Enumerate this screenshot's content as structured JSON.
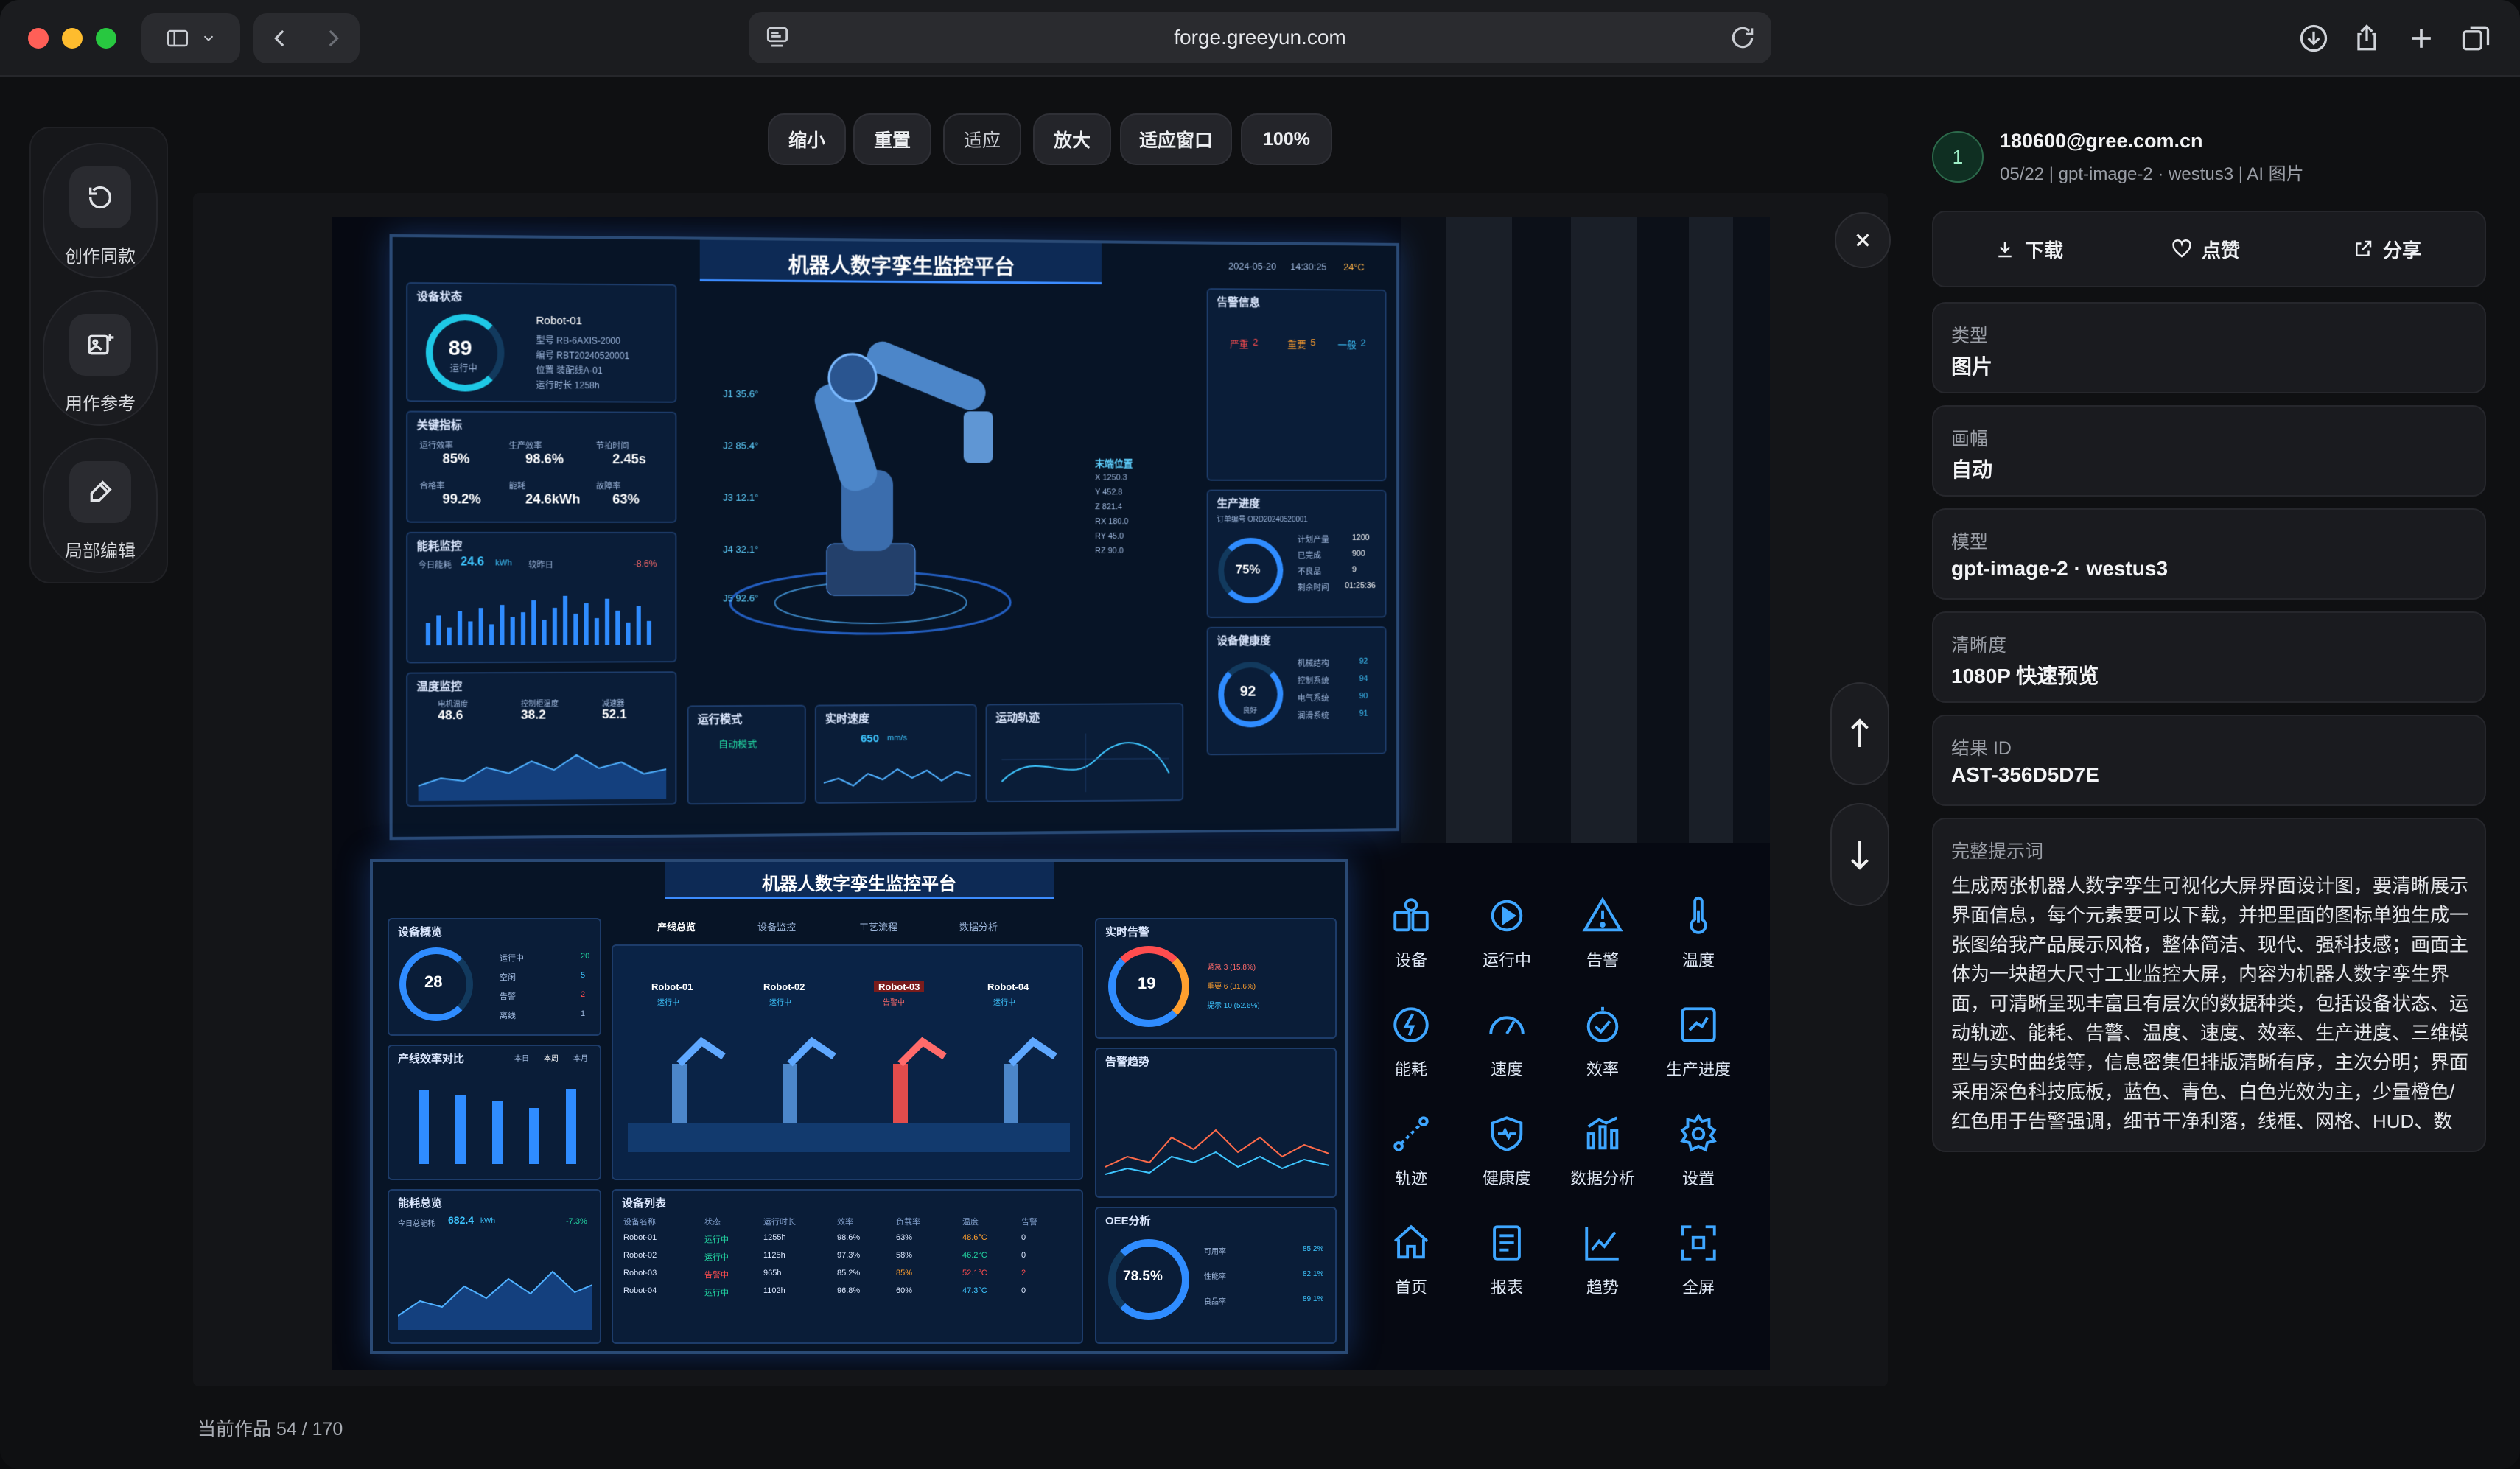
{
  "browser": {
    "url": "forge.greeyun.com"
  },
  "rail": {
    "items": [
      {
        "label": "创作同款",
        "icon": "rotate-ccw-icon"
      },
      {
        "label": "用作参考",
        "icon": "image-add-icon"
      },
      {
        "label": "局部编辑",
        "icon": "brush-edit-icon"
      }
    ]
  },
  "zoom": {
    "zoom_out": "缩小",
    "reset": "重置",
    "fit": "适应",
    "zoom_in": "放大",
    "fit_window": "适应窗口",
    "level": "100%"
  },
  "image": {
    "dashboard_title": "机器人数字孪生监控平台",
    "panel1": {
      "status_title": "设备状态",
      "status_value": "89",
      "status_sub": "运行中",
      "robot_name": "Robot-01",
      "model_line": "型号  RB-6AXIS-2000",
      "serial_line": "编号  RBT20240520001",
      "location_line": "位置  装配线A-01",
      "runtime_line": "运行时长  1258h",
      "kpi_title": "关键指标",
      "kpis": [
        {
          "label": "运行效率",
          "value": "85%"
        },
        {
          "label": "生产效率",
          "value": "98.6%"
        },
        {
          "label": "节拍时间",
          "value": "2.45s"
        },
        {
          "label": "合格率",
          "value": "99.2%"
        },
        {
          "label": "能耗",
          "value": "24.6kWh"
        },
        {
          "label": "故障率",
          "value": "63%"
        }
      ],
      "energy_title": "能耗监控",
      "energy_today": "今日能耗",
      "energy_value": "24.6",
      "energy_unit": "kWh",
      "energy_yoy": "较昨日",
      "energy_change": "-8.6%",
      "temp_title": "温度监控",
      "temps": [
        {
          "label": "电机温度",
          "value": "48.6"
        },
        {
          "label": "控制柜温度",
          "value": "38.2"
        },
        {
          "label": "减速器",
          "value": "52.1"
        }
      ],
      "mode_title": "运行模式",
      "mode_value": "自动模式",
      "speed_title": "实时速度",
      "speed_value": "650",
      "speed_unit": "mm/s",
      "track_title": "运动轨迹",
      "alarm_title": "告警信息",
      "alarm_counts": [
        {
          "label": "严重",
          "value": "2"
        },
        {
          "label": "重要",
          "value": "5"
        },
        {
          "label": "一般",
          "value": "2"
        }
      ],
      "progress_title": "生产进度",
      "progress_order": "订单编号  ORD20240520001",
      "progress_value": "75%",
      "progress_rows": [
        {
          "label": "计划产量",
          "value": "1200"
        },
        {
          "label": "已完成",
          "value": "900"
        },
        {
          "label": "不良品",
          "value": "9"
        },
        {
          "label": "剩余时间",
          "value": "01:25:36"
        }
      ],
      "health_title": "设备健康度",
      "health_value": "92",
      "health_sub": "良好",
      "health_rows": [
        {
          "label": "机械结构",
          "value": "92"
        },
        {
          "label": "控制系统",
          "value": "94"
        },
        {
          "label": "电气系统",
          "value": "90"
        },
        {
          "label": "润滑系统",
          "value": "91"
        }
      ],
      "joints": [
        "J1 35.6°",
        "J2 85.4°",
        "J3 12.1°",
        "J4 32.1°",
        "J5 92.6°"
      ],
      "end_pos_title": "末端位置",
      "end_pos": [
        "X 1250.3",
        "Y 452.8",
        "Z 821.4",
        "RX 180.0",
        "RY 45.0",
        "RZ 90.0"
      ],
      "date": "2024-05-20",
      "time": "14:30:25",
      "weather": "24°C"
    },
    "panel2": {
      "tabs": [
        "产线总览",
        "设备监控",
        "工艺流程",
        "数据分析"
      ],
      "overview_title": "设备概览",
      "overview_value": "28",
      "overview_rows": [
        {
          "label": "运行中",
          "value": "20"
        },
        {
          "label": "空闲",
          "value": "5"
        },
        {
          "label": "告警",
          "value": "2"
        },
        {
          "label": "离线",
          "value": "1"
        }
      ],
      "robots": [
        "Robot-01",
        "Robot-02",
        "Robot-03",
        "Robot-04"
      ],
      "robot_states": [
        "运行中",
        "运行中",
        "告警中",
        "运行中"
      ],
      "efficiency_title": "产线效率对比",
      "efficiency_tabs": [
        "本日",
        "本周",
        "本月"
      ],
      "energy_title": "能耗总览",
      "energy_today": "今日总能耗",
      "energy_value": "682.4",
      "energy_unit": "kWh",
      "energy_change": "-7.3%",
      "device_list_title": "设备列表",
      "device_headers": [
        "设备名称",
        "状态",
        "运行时长",
        "效率",
        "负载率",
        "温度",
        "告警"
      ],
      "device_rows": [
        [
          "Robot-01",
          "运行中",
          "1255h",
          "98.6%",
          "63%",
          "48.6°C",
          "0"
        ],
        [
          "Robot-02",
          "运行中",
          "1125h",
          "97.3%",
          "58%",
          "46.2°C",
          "0"
        ],
        [
          "Robot-03",
          "告警中",
          "965h",
          "85.2%",
          "85%",
          "52.1°C",
          "2"
        ],
        [
          "Robot-04",
          "运行中",
          "1102h",
          "96.8%",
          "60%",
          "47.3°C",
          "0"
        ]
      ],
      "alarm_title": "实时告警",
      "alarm_value": "19",
      "alarm_rows": [
        "紧急  3 (15.8%)",
        "重要  6 (31.6%)",
        "提示  10 (52.6%)"
      ],
      "trend_title": "告警趋势",
      "oee_title": "OEE分析",
      "oee_value": "78.5%",
      "oee_rows": [
        {
          "label": "可用率",
          "value": "85.2%"
        },
        {
          "label": "性能率",
          "value": "82.1%"
        },
        {
          "label": "良品率",
          "value": "89.1%"
        }
      ]
    },
    "icons": [
      {
        "label": "设备",
        "icon": "device-icon"
      },
      {
        "label": "运行中",
        "icon": "running-icon"
      },
      {
        "label": "告警",
        "icon": "alert-icon"
      },
      {
        "label": "温度",
        "icon": "thermometer-icon"
      },
      {
        "label": "能耗",
        "icon": "energy-icon"
      },
      {
        "label": "速度",
        "icon": "speed-icon"
      },
      {
        "label": "效率",
        "icon": "efficiency-icon"
      },
      {
        "label": "生产进度",
        "icon": "progress-icon"
      },
      {
        "label": "轨迹",
        "icon": "trajectory-icon"
      },
      {
        "label": "健康度",
        "icon": "health-icon"
      },
      {
        "label": "数据分析",
        "icon": "analytics-icon"
      },
      {
        "label": "设置",
        "icon": "settings-icon"
      },
      {
        "label": "首页",
        "icon": "home-icon"
      },
      {
        "label": "报表",
        "icon": "report-icon"
      },
      {
        "label": "趋势",
        "icon": "trend-icon"
      },
      {
        "label": "全屏",
        "icon": "fullscreen-icon"
      }
    ]
  },
  "panel": {
    "avatar": "1",
    "email": "180600@gree.com.cn",
    "meta": "05/22 | gpt-image-2 · westus3 | AI 图片",
    "download": "下载",
    "like": "点赞",
    "share": "分享",
    "type_label": "类型",
    "type_value": "图片",
    "size_label": "画幅",
    "size_value": "自动",
    "model_label": "模型",
    "model_value": "gpt-image-2 · westus3",
    "quality_label": "清晰度",
    "quality_value": "1080P 快速预览",
    "result_label": "结果 ID",
    "result_value": "AST-356D5D7E",
    "prompt_label": "完整提示词",
    "prompt_text": "生成两张机器人数字孪生可视化大屏界面设计图，要清晰展示界面信息，每个元素要可以下载，并把里面的图标单独生成一张图给我产品展示风格，整体简洁、现代、强科技感；画面主体为一块超大尺寸工业监控大屏，内容为机器人数字孪生界面，可清晰呈现丰富且有层次的数据种类，包括设备状态、运动轨迹、能耗、告警、温度、速度、效率、生产进度、三维模型与实时曲线等，信息密集但排版清晰有序，主次分明；界面采用深色科技底板，蓝色、青色、白色光效为主，少量橙色/红色用于告警强调，细节干净利落，线框、网格、HUD、数"
  },
  "footer": {
    "counter": "当前作品 54 / 170"
  },
  "colors": {
    "accent": "#3ea6ff",
    "alarm": "#ff4d4f",
    "warning": "#ff9f2e",
    "ok": "#22d3a0"
  }
}
